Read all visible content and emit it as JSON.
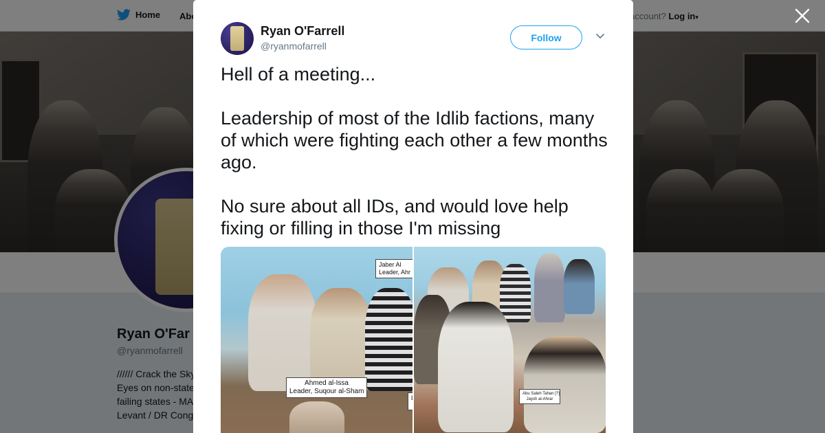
{
  "nav": {
    "home_label": "Home",
    "about_label": "Abo",
    "account_prefix": "account?",
    "login_label": "Log in"
  },
  "profile": {
    "name": "Ryan O'Far",
    "handle": "@ryanmofarrell",
    "bio_lines": [
      "////// Crack the Sky",
      "Eyes on non-state",
      "failing states - MA",
      "Levant / DR Cong"
    ]
  },
  "tweet": {
    "author_name": "Ryan O'Farrell",
    "author_handle": "@ryanmofarrell",
    "follow_label": "Follow",
    "paragraphs": [
      "Hell of a meeting...",
      "Leadership of most of the Idlib factions, many of which were fighting each other a few months ago.",
      "No sure about all IDs, and would love help fixing or filling in those I'm missing"
    ]
  },
  "photos": {
    "left": {
      "caption_top": "Jaber Al\nLeader, Ahr",
      "caption_main": "Ahmed al-Issa\nLeader, Suqour al-Sham",
      "caption_edge": "L"
    },
    "right": {
      "caption": "Abu Saleh Tahan [?]\nJaysh al-Ahrar"
    }
  },
  "icons": {
    "bird": "twitter-bird-icon",
    "close": "close-icon",
    "caret": "chevron-down-icon"
  },
  "colors": {
    "brand": "#1da1f2",
    "text": "#14171a",
    "muted": "#657786"
  }
}
